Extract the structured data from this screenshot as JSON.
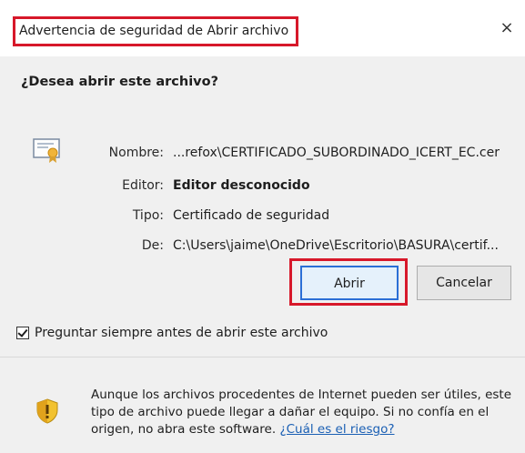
{
  "dialog": {
    "title": "Advertencia de seguridad de Abrir archivo",
    "close_glyph": "×",
    "question": "¿Desea abrir este archivo?",
    "fields": {
      "name_label": "Nombre:",
      "name_value": "...refox\\CERTIFICADO_SUBORDINADO_ICERT_EC.cer",
      "editor_label": "Editor:",
      "editor_value": "Editor desconocido",
      "type_label": "Tipo:",
      "type_value": "Certificado de seguridad",
      "from_label": "De:",
      "from_value": "C:\\Users\\jaime\\OneDrive\\Escritorio\\BASURA\\certif..."
    },
    "buttons": {
      "open_label": "Abrir",
      "cancel_label": "Cancelar"
    },
    "checkbox": {
      "label": "Preguntar siempre antes de abrir este archivo",
      "checked": true
    },
    "warning": {
      "text": "Aunque los archivos procedentes de Internet pueden ser útiles, este tipo de archivo puede llegar a dañar el equipo. Si no confía en el origen, no abra este software.",
      "link_text": "¿Cuál es el riesgo?"
    },
    "colors": {
      "highlight": "#d7182a",
      "link": "#1a5fb4",
      "background": "#f0f0f0"
    },
    "icons": {
      "file": "certificate-icon",
      "warning": "security-shield-icon"
    }
  }
}
